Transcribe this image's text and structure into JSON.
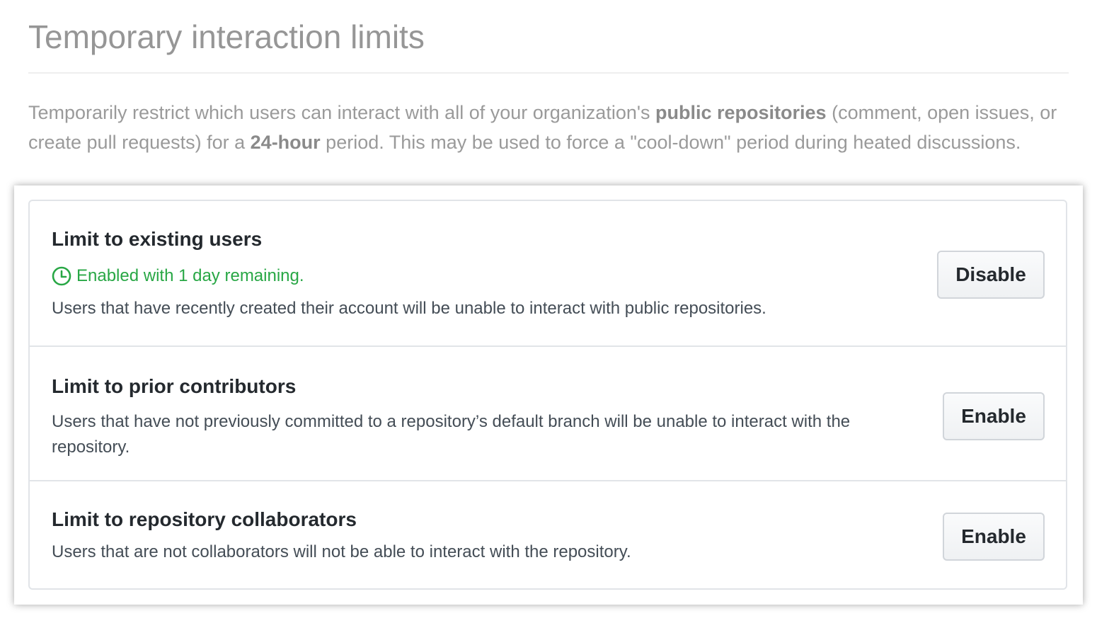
{
  "page": {
    "title": "Temporary interaction limits",
    "intro": {
      "part1": "Temporarily restrict which users can interact with all of your organization's ",
      "bold1": "public repositories",
      "part2": " (comment, open issues, or create pull requests) for a ",
      "bold2": "24-hour",
      "part3": " period. This may be used to force a \"cool-down\" period during heated discussions."
    }
  },
  "limits": [
    {
      "title": "Limit to existing users",
      "status": "Enabled with 1 day remaining.",
      "status_icon": "clock-icon",
      "description": "Users that have recently created their account will be unable to interact with public repositories.",
      "button_label": "Disable"
    },
    {
      "title": "Limit to prior contributors",
      "description": "Users that have not previously committed to a repository’s default branch will be unable to interact with the repository.",
      "button_label": "Enable"
    },
    {
      "title": "Limit to repository collaborators",
      "description": "Users that are not collaborators will not be able to interact with the repository.",
      "button_label": "Enable"
    }
  ],
  "colors": {
    "enabled_status": "#28a745",
    "border": "#e1e4e8",
    "muted_text": "#9a9a9a"
  }
}
